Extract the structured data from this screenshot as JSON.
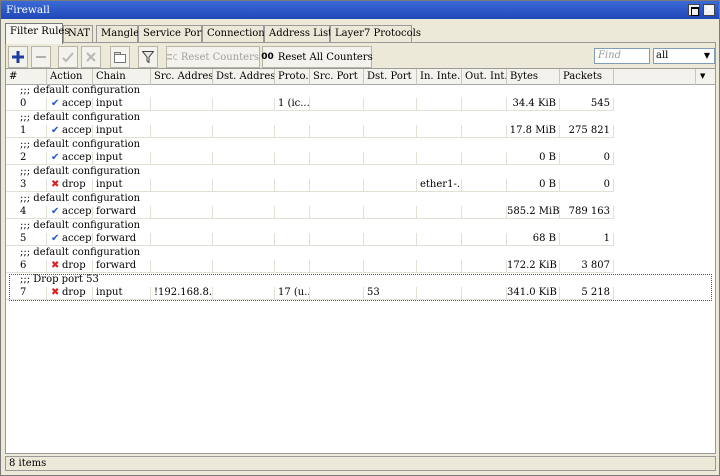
{
  "window": {
    "title": "Firewall",
    "close_glyph": "✕"
  },
  "tabs": [
    {
      "label": "Filter Rules",
      "active": true
    },
    {
      "label": "NAT"
    },
    {
      "label": "Mangle"
    },
    {
      "label": "Service Ports"
    },
    {
      "label": "Connections"
    },
    {
      "label": "Address Lists"
    },
    {
      "label": "Layer7 Protocols"
    }
  ],
  "toolbar": {
    "add_icon": "plus-icon",
    "remove_icon": "minus-icon",
    "enable_icon": "check-icon",
    "disable_icon": "x-icon",
    "comment_icon": "comment-icon",
    "filter_icon": "filter-icon",
    "reset_counters_label": "Reset Counters",
    "reset_all_counters_label": "Reset All Counters",
    "reset_all_glyph": "00",
    "find_placeholder": "Find",
    "filter_value": "all"
  },
  "columns": [
    "#",
    "Action",
    "Chain",
    "Src. Address",
    "Dst. Address",
    "Proto...",
    "Src. Port",
    "Dst. Port",
    "In. Inte...",
    "Out. Int...",
    "Bytes",
    "Packets"
  ],
  "rows": [
    {
      "comment": ";;; default configuration",
      "num": "0",
      "action": "accept",
      "chain": "input",
      "src": "",
      "dst": "",
      "proto": "1 (ic...",
      "sport": "",
      "dport": "",
      "in": "",
      "out": "",
      "bytes": "34.4 KiB",
      "packets": "545"
    },
    {
      "comment": ";;; default configuration",
      "num": "1",
      "action": "accept",
      "chain": "input",
      "src": "",
      "dst": "",
      "proto": "",
      "sport": "",
      "dport": "",
      "in": "",
      "out": "",
      "bytes": "17.8 MiB",
      "packets": "275 821"
    },
    {
      "comment": ";;; default configuration",
      "num": "2",
      "action": "accept",
      "chain": "input",
      "src": "",
      "dst": "",
      "proto": "",
      "sport": "",
      "dport": "",
      "in": "",
      "out": "",
      "bytes": "0 B",
      "packets": "0"
    },
    {
      "comment": ";;; default configuration",
      "num": "3",
      "action": "drop",
      "chain": "input",
      "src": "",
      "dst": "",
      "proto": "",
      "sport": "",
      "dport": "",
      "in": "ether1-...",
      "out": "",
      "bytes": "0 B",
      "packets": "0"
    },
    {
      "comment": ";;; default configuration",
      "num": "4",
      "action": "accept",
      "chain": "forward",
      "src": "",
      "dst": "",
      "proto": "",
      "sport": "",
      "dport": "",
      "in": "",
      "out": "",
      "bytes": "585.2 MiB",
      "packets": "789 163"
    },
    {
      "comment": ";;; default configuration",
      "num": "5",
      "action": "accept",
      "chain": "forward",
      "src": "",
      "dst": "",
      "proto": "",
      "sport": "",
      "dport": "",
      "in": "",
      "out": "",
      "bytes": "68 B",
      "packets": "1"
    },
    {
      "comment": ";;; default configuration",
      "num": "6",
      "action": "drop",
      "chain": "forward",
      "src": "",
      "dst": "",
      "proto": "",
      "sport": "",
      "dport": "",
      "in": "",
      "out": "",
      "bytes": "172.2 KiB",
      "packets": "3 807"
    },
    {
      "comment": ";;; Drop port 53",
      "num": "7",
      "action": "drop",
      "chain": "input",
      "src": "!192.168.8...",
      "dst": "",
      "proto": "17 (u...",
      "sport": "",
      "dport": "53",
      "in": "",
      "out": "",
      "bytes": "341.0 KiB",
      "packets": "5 218",
      "selected": true
    }
  ],
  "status": {
    "items_text": "8 items"
  },
  "colors": {
    "titlebar": "#2a55c8",
    "accept_icon": "#2255cc",
    "drop_icon": "#e02020"
  }
}
